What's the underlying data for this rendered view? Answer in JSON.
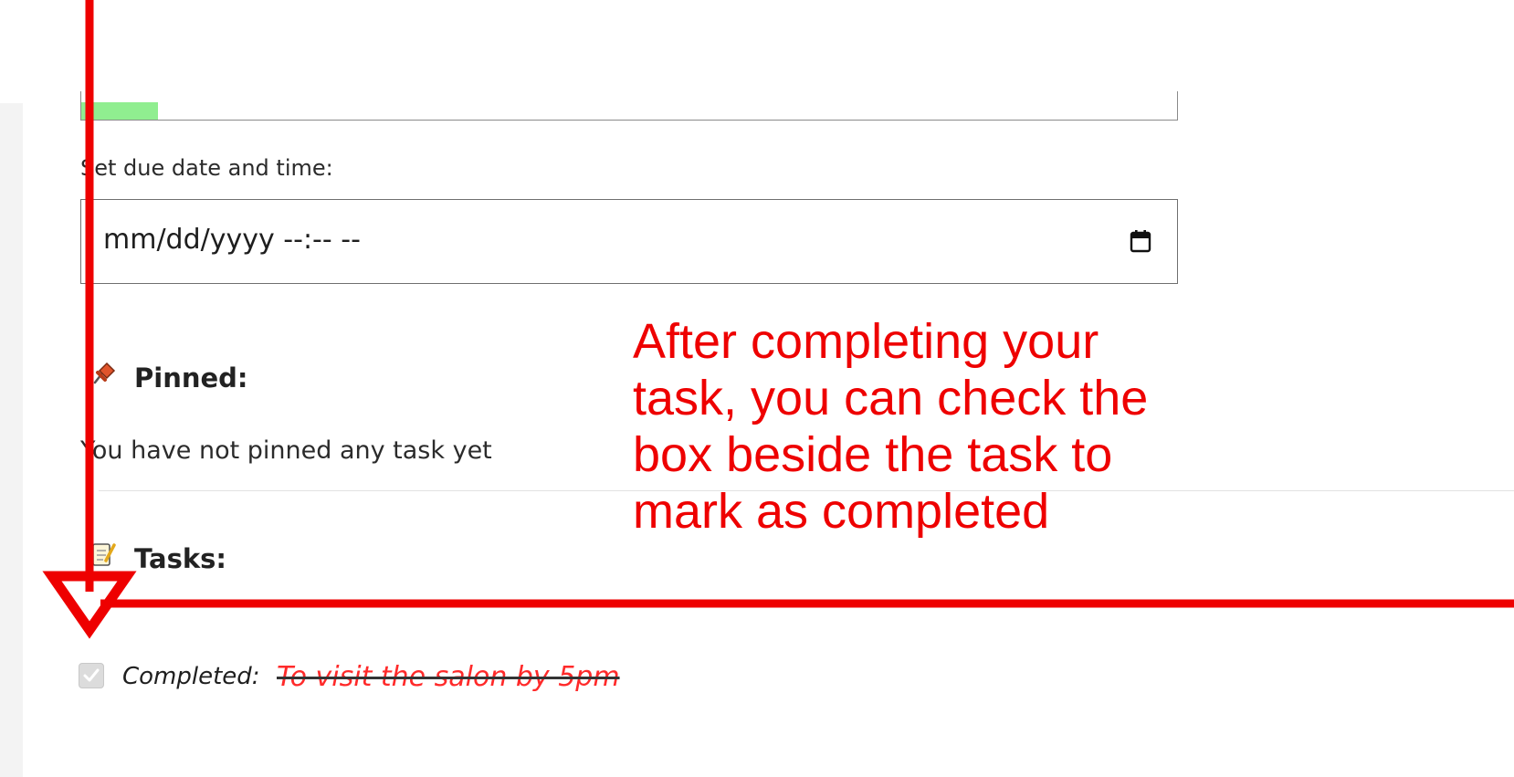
{
  "due_date": {
    "label": "Set due date and time:",
    "placeholder": "mm/dd/yyyy --:-- --"
  },
  "progress": {
    "fill_fraction": 0.07,
    "color": "#90ee90"
  },
  "pinned": {
    "heading": "Pinned:",
    "icon": "pushpin-icon",
    "empty_message": "You have not pinned any task yet"
  },
  "tasks": {
    "heading": "Tasks:",
    "icon": "memo-icon",
    "items": [
      {
        "status_label": "Completed:",
        "text": "To visit the salon by 5pm",
        "checked": true
      }
    ]
  },
  "annotation": {
    "text": "After completing your task, you can check the box beside the task to mark as completed",
    "color": "#ee0000"
  },
  "colors": {
    "completed_task": "#ff2a2a",
    "gutter": "#f3f3f3"
  }
}
